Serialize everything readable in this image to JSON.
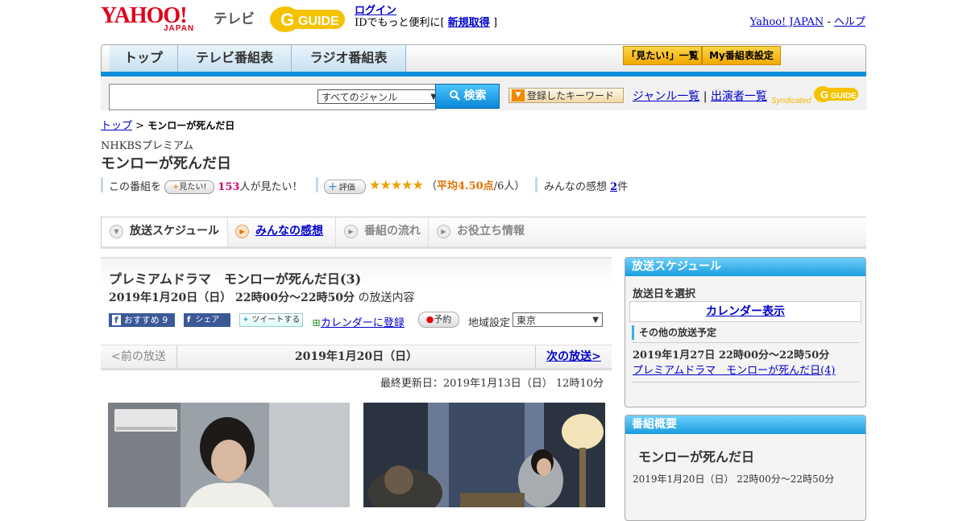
{
  "header": {
    "brand_word": "YAHOO!",
    "brand_sub": "JAPAN",
    "service": "テレビ",
    "gguide_text": "GUIDE",
    "login_link": "ログイン",
    "login_prefix": "IDでもっと便利に[",
    "signup_link": "新規取得",
    "login_suffix": "]",
    "yahoo_link": "Yahoo! JAPAN",
    "sep": "-",
    "help_link": "ヘルプ"
  },
  "gnav": {
    "tabs": [
      "トップ",
      "テレビ番組表",
      "ラジオ番組表"
    ],
    "btn_mitai": "「見たい!」一覧",
    "btn_my": "My番組表設定"
  },
  "search": {
    "genre": "すべてのジャンル",
    "button": "検索",
    "keyword_btn": "登録したキーワード",
    "genre_list": "ジャンル一覧",
    "divider": "|",
    "cast_list": "出演者一覧",
    "syndicated": "Syndicated"
  },
  "breadcrumb": {
    "top": "トップ",
    "sep": ">",
    "current": "モンローが死んだ日"
  },
  "program": {
    "channel": "NHKBSプレミアム",
    "title": "モンローが死んだ日",
    "want_prefix": "この番組を",
    "want_btn": "見たい!",
    "want_count": "153",
    "want_suffix": "人が見たい！",
    "rating_btn": "評価",
    "stars": "★★★★★",
    "rating_open": "（",
    "rating_avg_label": "平均4.50点",
    "rating_people": "/6人）",
    "review_label": "みんなの感想",
    "review_count": "2",
    "review_suffix": "件"
  },
  "subtabs": [
    "放送スケジュール",
    "みんなの感想",
    "番組の流れ",
    "お役立ち情報"
  ],
  "episode": {
    "title": "プレミアムドラマ　モンローが死んだ日(3)",
    "datetime": "2019年1月20日（日）  22時00分～22時50分",
    "datetime_suffix": "の放送内容",
    "fb_recommend": "おすすめ 9",
    "fb_share": "シェア",
    "tweet": "ツイートする",
    "calendar": "カレンダーに登録",
    "yoyaku": "予約",
    "region_label": "地域設定",
    "region": "東京"
  },
  "datenav": {
    "prev": "<前の放送",
    "current": "2019年1月20日（日）",
    "next": "次の放送>"
  },
  "updated": "最終更新日：2019年1月13日（日）  12時10分",
  "sidebar": {
    "schedule_head": "放送スケジュール",
    "select_day": "放送日を選択",
    "calendar_btn": "カレンダー表示",
    "other_head": "その他の放送予定",
    "other_date": "2019年1月27日  22時00分～22時50分",
    "other_link": "プレミアムドラマ　モンローが死んだ日(4)",
    "overview_head": "番組概要",
    "overview_title": "モンローが死んだ日",
    "overview_time": "2019年1月20日（日）  22時00分～22時50分"
  }
}
